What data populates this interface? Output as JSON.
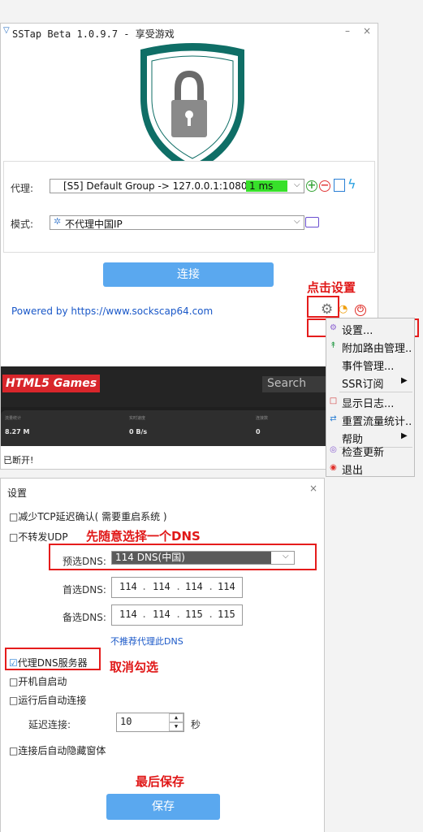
{
  "main_window": {
    "title": "SSTap Beta 1.0.9.7 - 享受游戏",
    "minimize": "–",
    "close": "×",
    "proxy_label": "代理:",
    "proxy_value": "[S5] Default Group -> 127.0.0.1:1080",
    "latency": "1 ms",
    "mode_label": "模式:",
    "mode_value": "不代理中国IP",
    "connect_button": "连接",
    "powered_by": "Powered by https://www.sockscap64.com",
    "status": "已断开!"
  },
  "banner": {
    "logo": "HTML5 Games",
    "search_placeholder": "Search",
    "stats": [
      {
        "label": "流量统计",
        "value": "8.27 M"
      },
      {
        "label": "实时速度",
        "value": "0 B/s"
      },
      {
        "label": "连接数",
        "value": "0"
      }
    ]
  },
  "annotations": {
    "click_settings": "点击设置",
    "choose_dns": "先随意选择一个DNS",
    "uncheck": "取消勾选",
    "save_last": "最后保存"
  },
  "context_menu": {
    "items": [
      {
        "label": "设置...",
        "icon": "gear-icon",
        "color": "#8a5fd1"
      },
      {
        "label": "附加路由管理..",
        "icon": "route-icon",
        "color": "#2a9d4a"
      },
      {
        "label": "事件管理...",
        "icon": "",
        "color": ""
      },
      {
        "label": "SSR订阅",
        "icon": "",
        "color": "",
        "submenu": "▶"
      },
      {
        "label": "显示日志...",
        "icon": "log-icon",
        "color": "#d04040"
      },
      {
        "label": "重置流量统计..",
        "icon": "reset-icon",
        "color": "#2a7fd4"
      },
      {
        "label": "帮助",
        "icon": "",
        "color": "",
        "submenu": "▶"
      },
      {
        "label": "检查更新",
        "icon": "update-icon",
        "color": "#8a5fd1"
      },
      {
        "label": "退出",
        "icon": "exit-icon",
        "color": "#e0302a"
      }
    ]
  },
  "settings_window": {
    "title": "设置",
    "close": "×",
    "reduce_tcp": "减少TCP延迟确认( 需要重启系统 )",
    "no_udp": "不转发UDP",
    "preset_dns_label": "预选DNS:",
    "preset_dns_value": "114 DNS(中国)",
    "primary_dns_label": "首选DNS:",
    "primary_dns": [
      "114",
      "114",
      "114",
      "114"
    ],
    "secondary_dns_label": "备选DNS:",
    "secondary_dns": [
      "114",
      "114",
      "115",
      "115"
    ],
    "not_recommended": "不推荐代理此DNS",
    "proxy_dns": "代理DNS服务器",
    "autostart": "开机自启动",
    "autoconnect": "运行后自动连接",
    "delay_label": "延迟连接:",
    "delay_value": "10",
    "delay_unit": "秒",
    "autohide": "连接后自动隐藏窗体",
    "save_button": "保存"
  }
}
